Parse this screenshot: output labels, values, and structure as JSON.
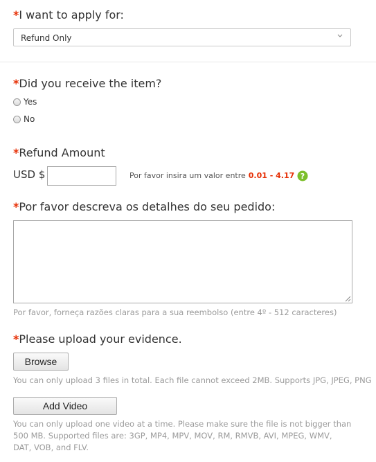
{
  "apply_for": {
    "star": "*",
    "label": "I want to apply for:",
    "selected": "Refund Only"
  },
  "received": {
    "star": "*",
    "label": "Did you receive the item?",
    "options": [
      "Yes",
      "No"
    ]
  },
  "refund": {
    "star": "*",
    "label": "Refund Amount",
    "currency": "USD $",
    "hint": "Por favor insira um valor entre",
    "range": "0.01 - 4.17",
    "help_icon": "question-circle-icon",
    "help_icon_color": "#7cbf2a"
  },
  "details": {
    "star": "*",
    "label": "Por favor descreva os detalhes do seu pedido:",
    "hint": "Por favor, forneça razões claras para a sua reembolso (entre 4º - 512 caracteres)"
  },
  "evidence": {
    "star": "*",
    "label": "Please upload your evidence.",
    "browse_label": "Browse",
    "browse_note": "You can only upload 3 files in total. Each file cannot exceed 2MB. Supports JPG, JPEG, PNG",
    "video_label": "Add Video",
    "video_note": "You can only upload one video at a time. Please make sure the file is not bigger than 500 MB. Supported files are: 3GP, MP4, MPV, MOV, RM, RMVB, AVI, MPEG, WMV, DAT, VOB, and FLV."
  },
  "colors": {
    "required_star": "#e62e04",
    "range_text": "#e62e04"
  }
}
